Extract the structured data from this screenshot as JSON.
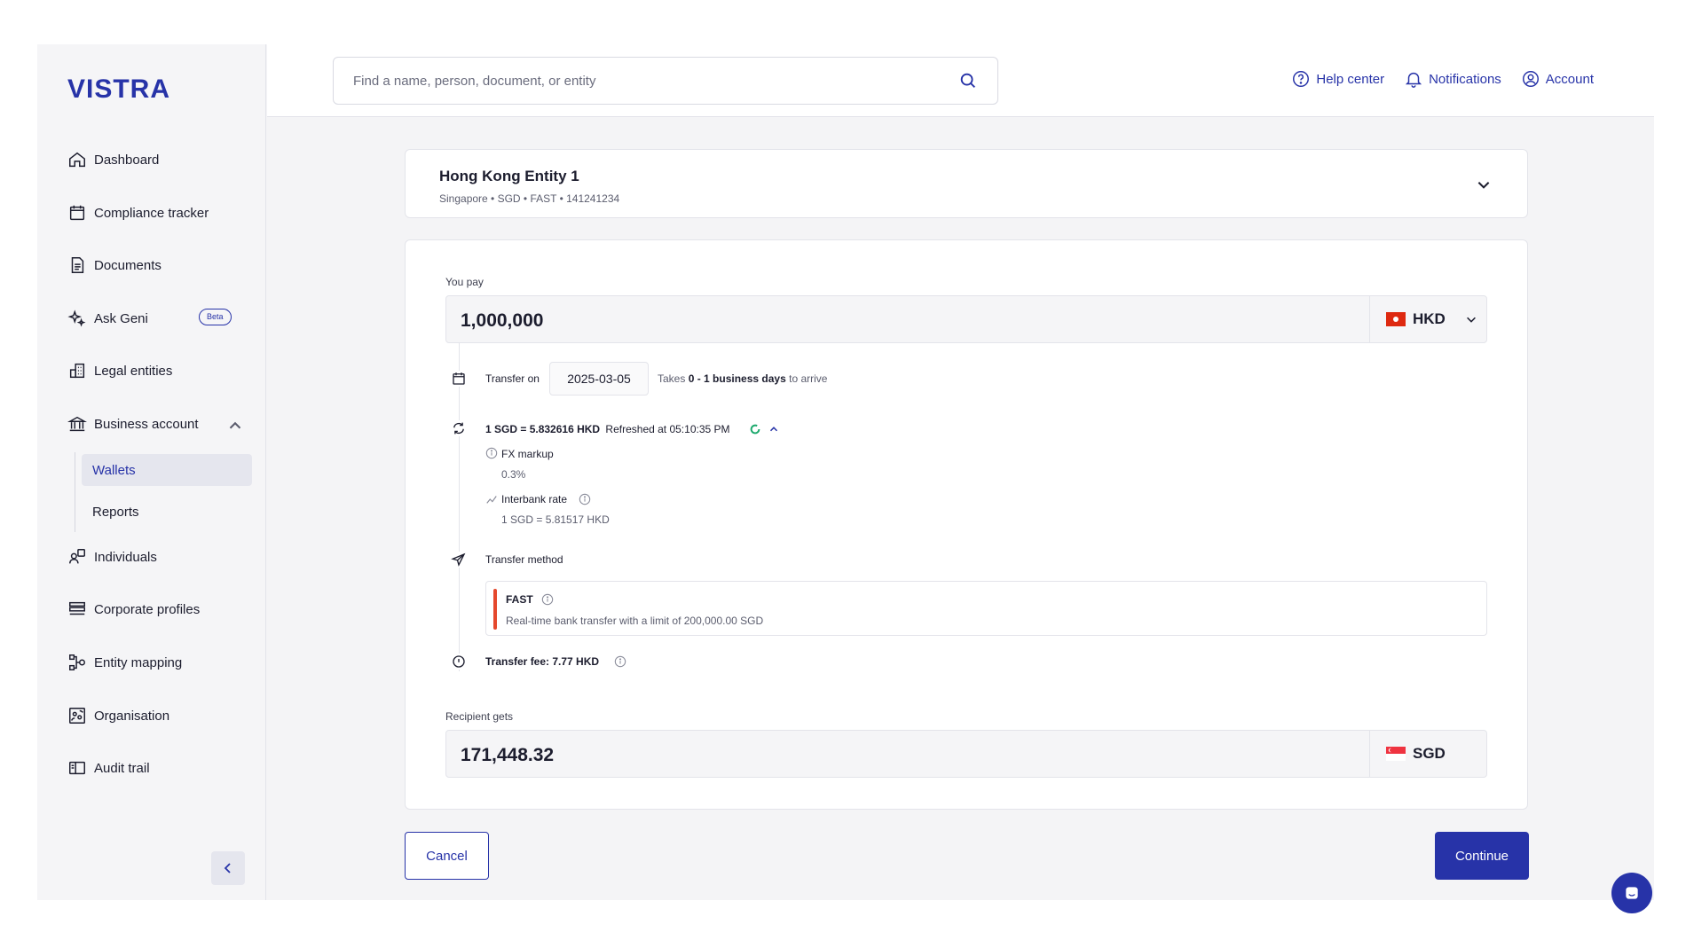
{
  "brand": {
    "logo_text": "VISTRA",
    "accent": "#2733a8"
  },
  "sidebar": {
    "items": [
      {
        "label": "Dashboard",
        "icon": "home-icon"
      },
      {
        "label": "Compliance tracker",
        "icon": "calendar-icon"
      },
      {
        "label": "Documents",
        "icon": "document-icon"
      },
      {
        "label": "Ask Geni",
        "icon": "sparkle-icon",
        "badge": "Beta"
      },
      {
        "label": "Legal entities",
        "icon": "building-icon"
      },
      {
        "label": "Business account",
        "icon": "bank-icon"
      },
      {
        "label": "Individuals",
        "icon": "people-icon"
      },
      {
        "label": "Corporate profiles",
        "icon": "list-icon"
      },
      {
        "label": "Entity mapping",
        "icon": "mapping-icon"
      },
      {
        "label": "Organisation",
        "icon": "org-icon"
      },
      {
        "label": "Audit trail",
        "icon": "book-icon"
      }
    ],
    "sub_items": [
      {
        "label": "Wallets",
        "active": true
      },
      {
        "label": "Reports",
        "active": false
      }
    ]
  },
  "header": {
    "search_placeholder": "Find a name, person, document, or entity",
    "help": "Help center",
    "notifications": "Notifications",
    "account": "Account"
  },
  "entity": {
    "name": "Hong Kong Entity 1",
    "details": "Singapore • SGD • FAST • 141241234"
  },
  "form": {
    "you_pay_label": "You pay",
    "you_pay_amount": "1,000,000",
    "you_pay_currency": "HKD",
    "transfer_on_label": "Transfer on",
    "transfer_date": "2025-03-05",
    "takes_prefix": "Takes",
    "takes_days": "0 - 1 business days",
    "takes_suffix": "to arrive",
    "rate": "1 SGD = 5.832616 HKD",
    "refreshed": "Refreshed at 05:10:35 PM",
    "fx_markup_label": "FX markup",
    "fx_markup_value": "0.3%",
    "interbank_label": "Interbank rate",
    "interbank_value": "1 SGD = 5.81517 HKD",
    "transfer_method_label": "Transfer method",
    "method_name": "FAST",
    "method_desc": "Real-time bank transfer with a limit of 200,000.00 SGD",
    "transfer_fee": "Transfer fee: 7.77 HKD",
    "recipient_label": "Recipient gets",
    "recipient_amount": "171,448.32",
    "recipient_currency": "SGD"
  },
  "actions": {
    "cancel": "Cancel",
    "continue": "Continue"
  }
}
